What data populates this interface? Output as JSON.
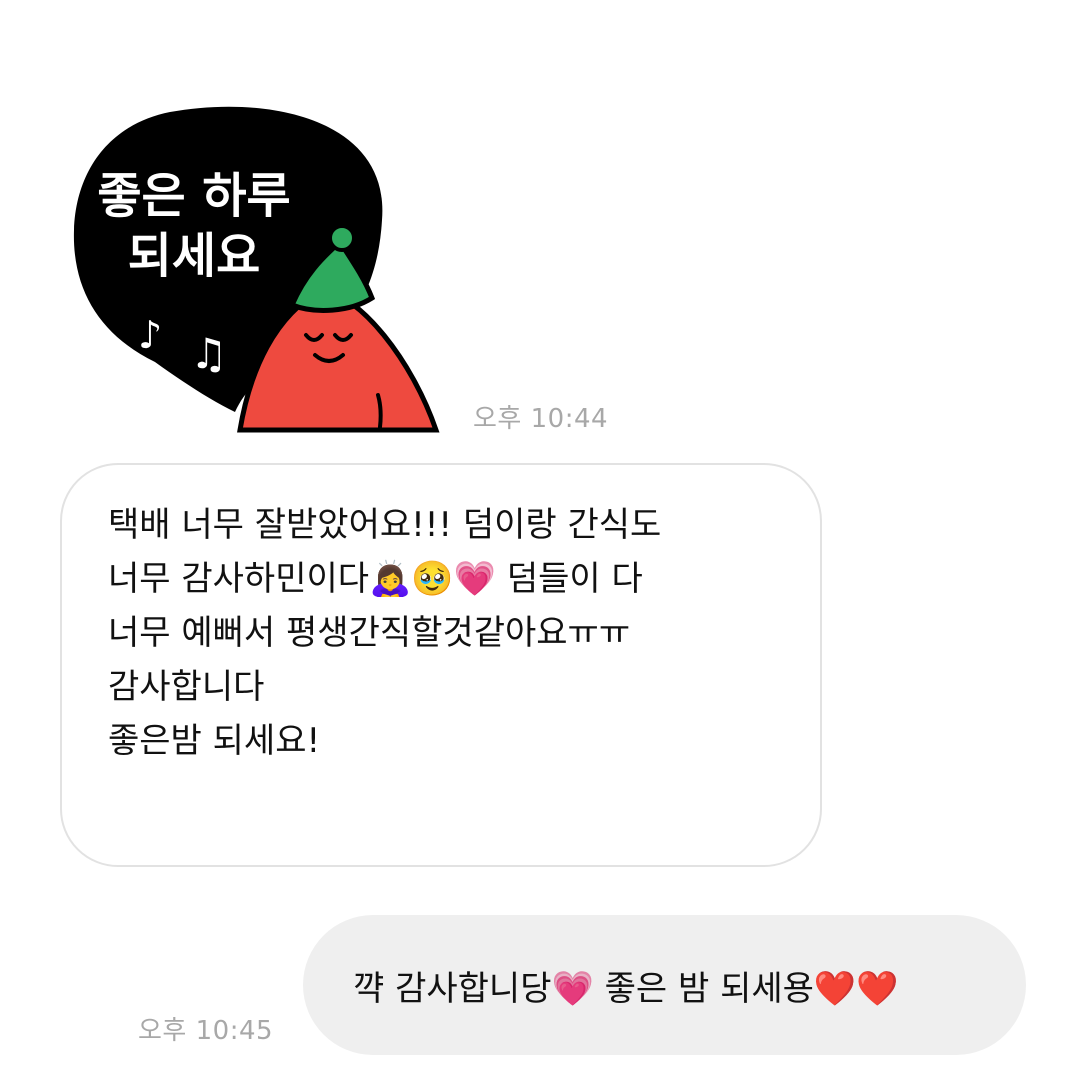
{
  "sticker": {
    "line1": "좋은 하루",
    "line2": "되세요",
    "colors": {
      "bubble": "#000000",
      "body": "#ee4a3f",
      "hat": "#2eaa5e",
      "text": "#ffffff"
    }
  },
  "messages": {
    "received": {
      "lines": [
        "택배 너무 잘받았어요!!! 덤이랑 간식도",
        "너무 감사하민이다🙇‍♀️🥹💗 덤들이 다",
        "너무 예뻐서 평생간직할것같아요ㅠㅠ",
        "감사합니다",
        "좋은밤 되세요!"
      ]
    },
    "sent": {
      "text": "꺅 감사합니당💗 좋은 밤 되세용❤️❤️"
    }
  },
  "timestamps": {
    "sticker_time": "오후 10:44",
    "sent_time": "오후 10:45"
  }
}
